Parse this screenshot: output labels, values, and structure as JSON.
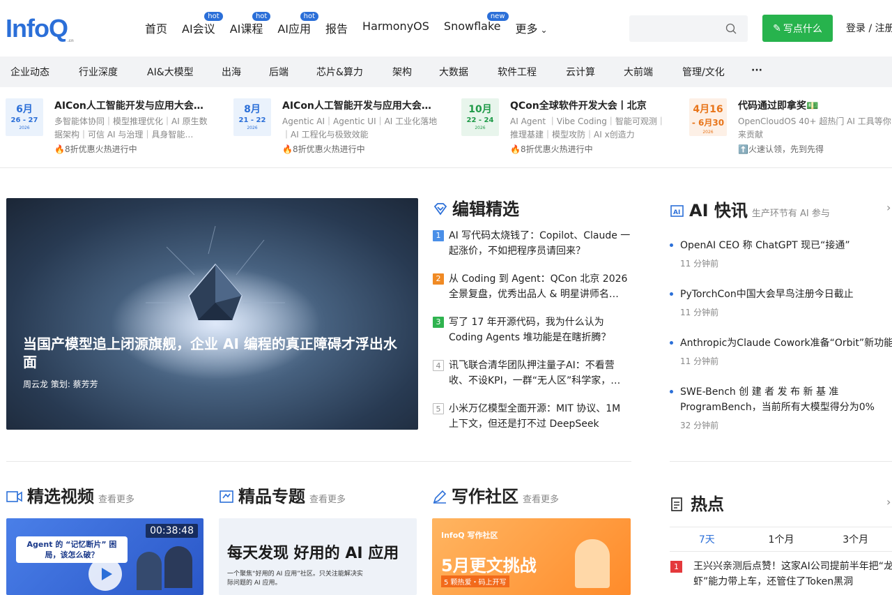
{
  "header": {
    "logo": "InfoQ",
    "nav": [
      {
        "label": "首页",
        "badge": ""
      },
      {
        "label": "AI会议",
        "badge": "hot"
      },
      {
        "label": "AI课程",
        "badge": "hot"
      },
      {
        "label": "AI应用",
        "badge": "hot"
      },
      {
        "label": "报告",
        "badge": ""
      },
      {
        "label": "HarmonyOS",
        "badge": ""
      },
      {
        "label": "Snowflake",
        "badge": "new"
      },
      {
        "label": "更多",
        "badge": ""
      }
    ],
    "search_placeholder": "",
    "write_label": "写点什么",
    "login_label": "登录 / 注册"
  },
  "categories": [
    "企业动态",
    "行业深度",
    "AI&大模型",
    "出海",
    "后端",
    "芯片&算力",
    "架构",
    "大数据",
    "软件工程",
    "云计算",
    "大前端",
    "管理/文化",
    "···"
  ],
  "events": [
    {
      "month": "6月",
      "days": "26 - 27",
      "year": "2026",
      "title": "AICon人工智能开发与应用大会…",
      "desc": "多智能体协同｜模型推理优化｜AI 原生数据架构｜可信 AI 与治理｜具身智能…",
      "promo": "🔥8折优惠火热进行中",
      "bg": "#eaf2fc",
      "color": "#2b6fd8"
    },
    {
      "month": "8月",
      "days": "21 - 22",
      "year": "2026",
      "title": "AICon人工智能开发与应用大会…",
      "desc": "Agentic AI｜Agentic UI｜AI 工业化落地｜AI 工程化与极致效能",
      "promo": "🔥8折优惠火热进行中",
      "bg": "#eaf2fc",
      "color": "#2b6fd8"
    },
    {
      "month": "10月",
      "days": "22 - 24",
      "year": "2026",
      "title": "QCon全球软件开发大会丨北京",
      "desc": "AI Agent ｜Vibe Coding｜智能可观测｜推理基建｜模型攻防｜AI x创造力",
      "promo": "🔥8折优惠火热进行中",
      "bg": "#e8f5ec",
      "color": "#1f9a48"
    },
    {
      "month": "4月16",
      "days": "- 6月30",
      "year": "2026",
      "title": "代码通过即拿奖💵",
      "desc": "OpenCloudOS 40+ 超热门 AI 工具等你来贡献",
      "promo": "⬆️火速认领，先到先得",
      "bg": "#fdf0e6",
      "color": "#e8751a"
    }
  ],
  "hero": {
    "title": "当国产模型追上闭源旗舰，企业 AI 编程的真正障碍才浮出水面",
    "meta": "周云龙 策划: 蔡芳芳"
  },
  "picks": {
    "title": "编辑精选",
    "items": [
      {
        "num": "1",
        "text": "AI 写代码太烧钱了：Copilot、Claude 一起涨价，不如把程序员请回来？",
        "color": "#4a8fe8"
      },
      {
        "num": "2",
        "text": "从 Coding 到 Agent：QCon 北京 2026 全景复盘，优秀出品人 & 明星讲师名…",
        "color": "#f08a24"
      },
      {
        "num": "3",
        "text": "写了 17 年开源代码，我为什么认为 Coding Agents 堆功能是在瞎折腾？",
        "color": "#2fb34f"
      },
      {
        "num": "4",
        "text": "讯飞联合清华团队押注量子AI：不看营收、不设KPI，一群“无人区”科学家，…",
        "color": ""
      },
      {
        "num": "5",
        "text": "小米万亿模型全面开源：MIT 协议、1M 上下文，但还是打不过 DeepSeek",
        "color": ""
      }
    ]
  },
  "ainews": {
    "title": "AI 快讯",
    "subtitle": "生产环节有 AI 参与",
    "items": [
      {
        "text": "OpenAI CEO 称 ChatGPT 现已“接通”",
        "time": "11 分钟前"
      },
      {
        "text": "PyTorchCon中国大会早鸟注册今日截止",
        "time": "11 分钟前"
      },
      {
        "text": "Anthropic为Claude Cowork准备“Orbit”新功能",
        "time": "11 分钟前"
      },
      {
        "text": "SWE-Bench 创 建 者 发 布 新 基 准 ProgramBench，当前所有大模型得分为0%",
        "time": "32 分钟前"
      }
    ]
  },
  "videos": {
    "title": "精选视频",
    "more": "查看更多",
    "duration": "00:38:48",
    "card_text": "Agent 的 “记忆断片” 困局，该怎么破？"
  },
  "topics": {
    "title": "精品专题",
    "more": "查看更多",
    "card_text": "每天发现 好用的 AI 应用",
    "card_sub": "一个聚焦“好用的 AI 应用”社区。只关注能解决实际问题的 AI 应用。"
  },
  "writing": {
    "title": "写作社区",
    "more": "查看更多",
    "card_brand": "InfoQ 写作社区",
    "card_text": "5月更文挑战",
    "card_sub": "5 颗热爱・码上开写"
  },
  "hot": {
    "title": "热点",
    "tabs": [
      "7天",
      "1个月",
      "3个月"
    ],
    "items": [
      {
        "num": "1",
        "text": "王兴兴亲测后点赞！这家AI公司提前半年把“龙虾”能力带上车，还管住了Token黑洞"
      }
    ]
  }
}
